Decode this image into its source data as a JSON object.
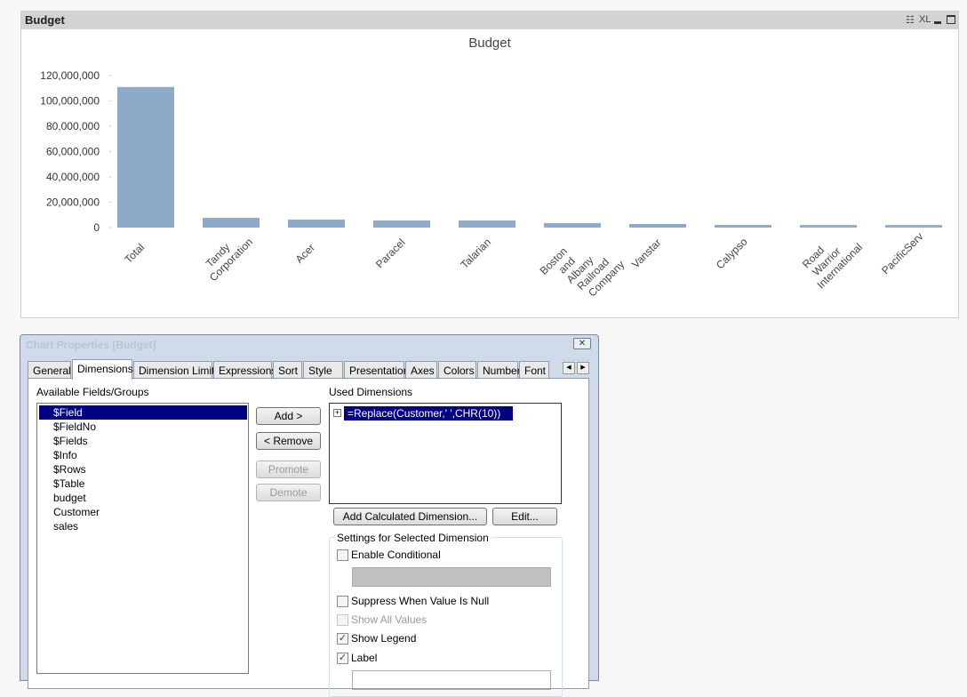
{
  "panel": {
    "title": "Budget",
    "icons": [
      "print-icon",
      "xl-icon",
      "minimize-icon",
      "maximize-icon"
    ],
    "xl_label": "XL"
  },
  "chart_data": {
    "type": "bar",
    "title": "Budget",
    "xlabel": "",
    "ylabel": "",
    "ylim": [
      0,
      120000000
    ],
    "yticks": [
      "0",
      "20,000,000",
      "40,000,000",
      "60,000,000",
      "80,000,000",
      "100,000,000",
      "120,000,000"
    ],
    "categories": [
      "Total",
      "Tandy Corporation",
      "Acer",
      "Paracel",
      "Talarian",
      "Boston and Albany Railroad Company",
      "Vanstar",
      "Calypso",
      "Road Warrior International",
      "PacificServ"
    ],
    "values": [
      111000000,
      7700000,
      6300000,
      5600000,
      5600000,
      3500000,
      2800000,
      2100000,
      2000000,
      2000000
    ],
    "color": "#8eaac9",
    "grid": false
  },
  "dialog": {
    "title": "Chart Properties [Budget]",
    "tabs": [
      "General",
      "Dimensions",
      "Dimension Limits",
      "Expressions",
      "Sort",
      "Style",
      "Presentation",
      "Axes",
      "Colors",
      "Number",
      "Font"
    ],
    "available_label": "Available Fields/Groups",
    "fields": [
      "$Field",
      "$FieldNo",
      "$Fields",
      "$Info",
      "$Rows",
      "$Table",
      "budget",
      "Customer",
      "sales"
    ],
    "buttons": {
      "add": "Add >",
      "remove": "< Remove",
      "promote": "Promote",
      "demote": "Demote",
      "add_calc": "Add Calculated Dimension...",
      "edit": "Edit..."
    },
    "used_label": "Used Dimensions",
    "used": [
      "=Replace(Customer,' ',CHR(10))"
    ],
    "settings_label": "Settings for Selected Dimension",
    "options": [
      {
        "label": "Enable Conditional",
        "checked": false
      },
      {
        "label": "Suppress When Value Is Null",
        "checked": false
      },
      {
        "label": "Show All Values",
        "checked": false,
        "disabled": true
      },
      {
        "label": "Show Legend",
        "checked": true
      },
      {
        "label": "Label",
        "checked": true
      }
    ]
  }
}
